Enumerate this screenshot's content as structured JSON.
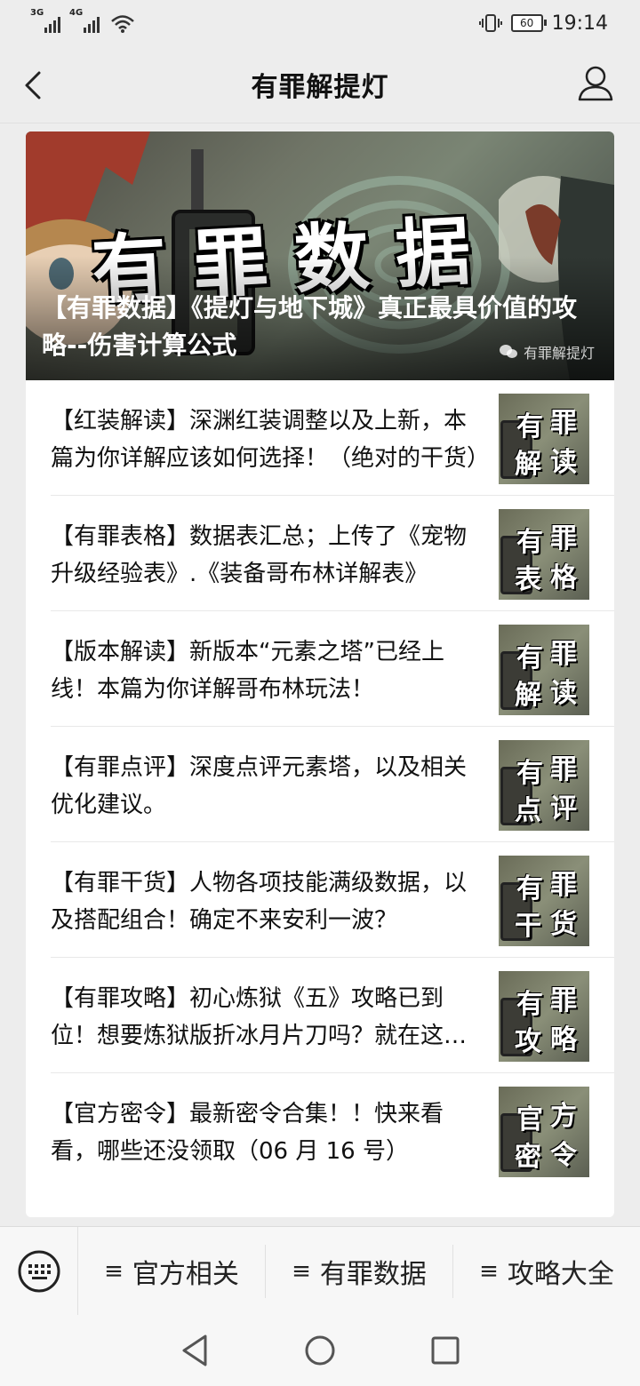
{
  "status_bar": {
    "signal1_label": "3G",
    "signal2_label": "4G",
    "battery": "60",
    "time": "19:14"
  },
  "header": {
    "title": "有罪解提灯"
  },
  "banner": {
    "big_text": "有罪数据",
    "headline": "【有罪数据】《提灯与地下城》真正最具价值的攻略--伤害计算公式",
    "watermark": "有罪解提灯"
  },
  "articles": [
    {
      "text": "【红装解读】深渊红装调整以及上新，本篇为你详解应该如何选择！（绝对的干货）",
      "thumb": [
        "有",
        "罪",
        "解",
        "读"
      ]
    },
    {
      "text": "【有罪表格】数据表汇总；上传了《宠物升级经验表》.《装备哥布林详解表》",
      "thumb": [
        "有",
        "罪",
        "表",
        "格"
      ]
    },
    {
      "text": "【版本解读】新版本“元素之塔”已经上线！本篇为你详解哥布林玩法！",
      "thumb": [
        "有",
        "罪",
        "解",
        "读"
      ]
    },
    {
      "text": "【有罪点评】深度点评元素塔，以及相关优化建议。",
      "thumb": [
        "有",
        "罪",
        "点",
        "评"
      ]
    },
    {
      "text": "【有罪干货】人物各项技能满级数据，以及搭配组合！确定不来安利一波？",
      "thumb": [
        "有",
        "罪",
        "干",
        "货"
      ]
    },
    {
      "text": "【有罪攻略】初心炼狱《五》攻略已到位！想要炼狱版折冰月片刀吗？就在这里！",
      "thumb": [
        "有",
        "罪",
        "攻",
        "略"
      ]
    },
    {
      "text": "【官方密令】最新密令合集！！快来看看，哪些还没领取（06 月 16 号）",
      "thumb": [
        "官",
        "方",
        "密",
        "令"
      ]
    }
  ],
  "menu": {
    "items": [
      {
        "icon": "≡",
        "label": "官方相关"
      },
      {
        "icon": "≡",
        "label": "有罪数据"
      },
      {
        "icon": "≡",
        "label": "攻略大全"
      }
    ]
  }
}
